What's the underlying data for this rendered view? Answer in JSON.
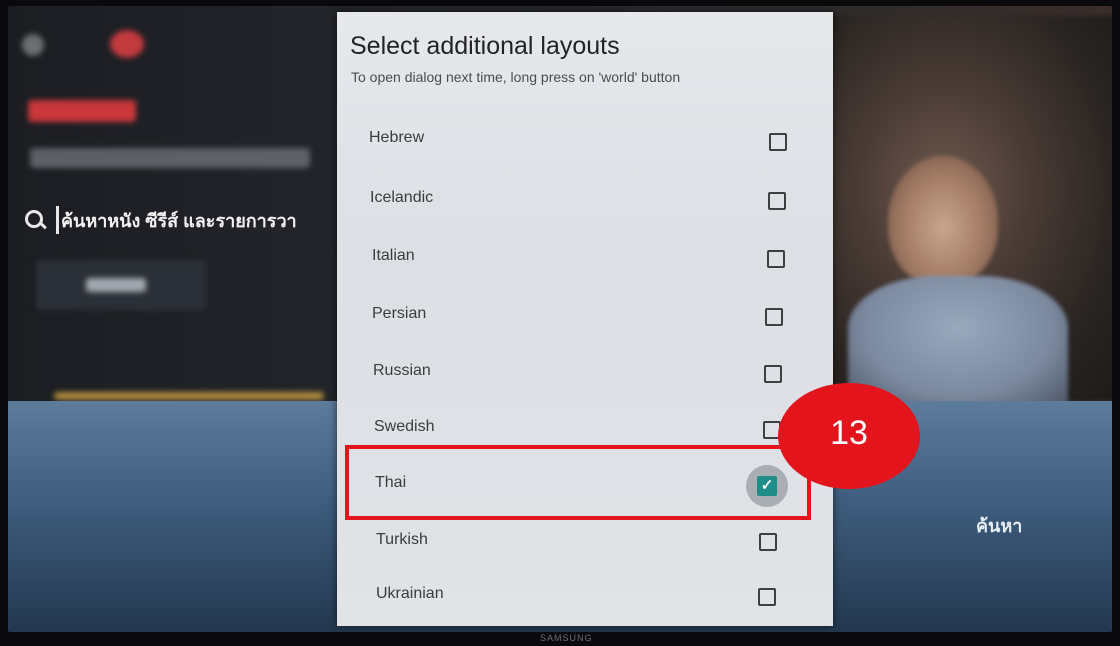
{
  "dialog": {
    "title": "Select additional layouts",
    "subtitle": "To open dialog next time, long press on 'world' button",
    "items": [
      {
        "label": "Hebrew",
        "checked": false
      },
      {
        "label": "Icelandic",
        "checked": false
      },
      {
        "label": "Italian",
        "checked": false
      },
      {
        "label": "Persian",
        "checked": false
      },
      {
        "label": "Russian",
        "checked": false
      },
      {
        "label": "Swedish",
        "checked": false
      },
      {
        "label": "Thai",
        "checked": true
      },
      {
        "label": "Turkish",
        "checked": false
      },
      {
        "label": "Ukrainian",
        "checked": false
      }
    ]
  },
  "background": {
    "search_text": "ค้นหาหนัง ซีรีส์ และรายการวา",
    "right_label": "ค้นหา",
    "edge_glyphs": [
      "&",
      "?"
    ]
  },
  "annotation": {
    "step_number": "13"
  },
  "colors": {
    "checkbox_checked": "#1f8e8a",
    "annotation_red": "#e3141b"
  }
}
